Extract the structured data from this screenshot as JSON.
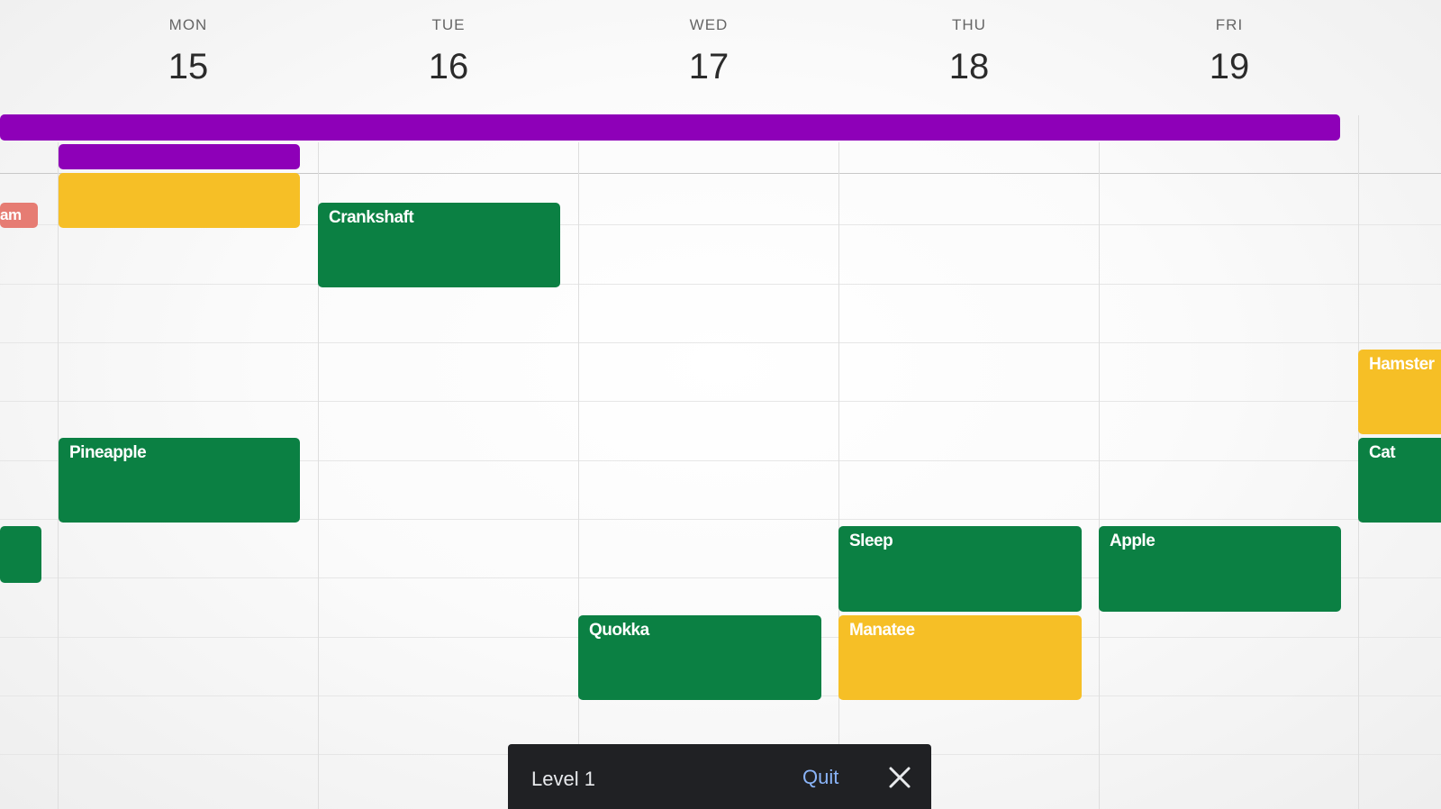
{
  "days": [
    {
      "name": "MON",
      "num": "15"
    },
    {
      "name": "TUE",
      "num": "16"
    },
    {
      "name": "WED",
      "num": "17"
    },
    {
      "name": "THU",
      "num": "18"
    },
    {
      "name": "FRI",
      "num": "19"
    }
  ],
  "events": {
    "left_edge_red": "am",
    "crankshaft": "Crankshaft",
    "pineapple": "Pineapple",
    "sleep": "Sleep",
    "apple": "Apple",
    "quokka": "Quokka",
    "manatee": "Manatee",
    "hamster": "Hamster",
    "cat": "Cat"
  },
  "colors": {
    "green": "#0b8043",
    "yellow": "#f6bf26",
    "purple": "#8e00b8",
    "red": "#e67c73"
  },
  "toast": {
    "label": "Level 1",
    "quit": "Quit",
    "close_icon": "close-icon"
  }
}
